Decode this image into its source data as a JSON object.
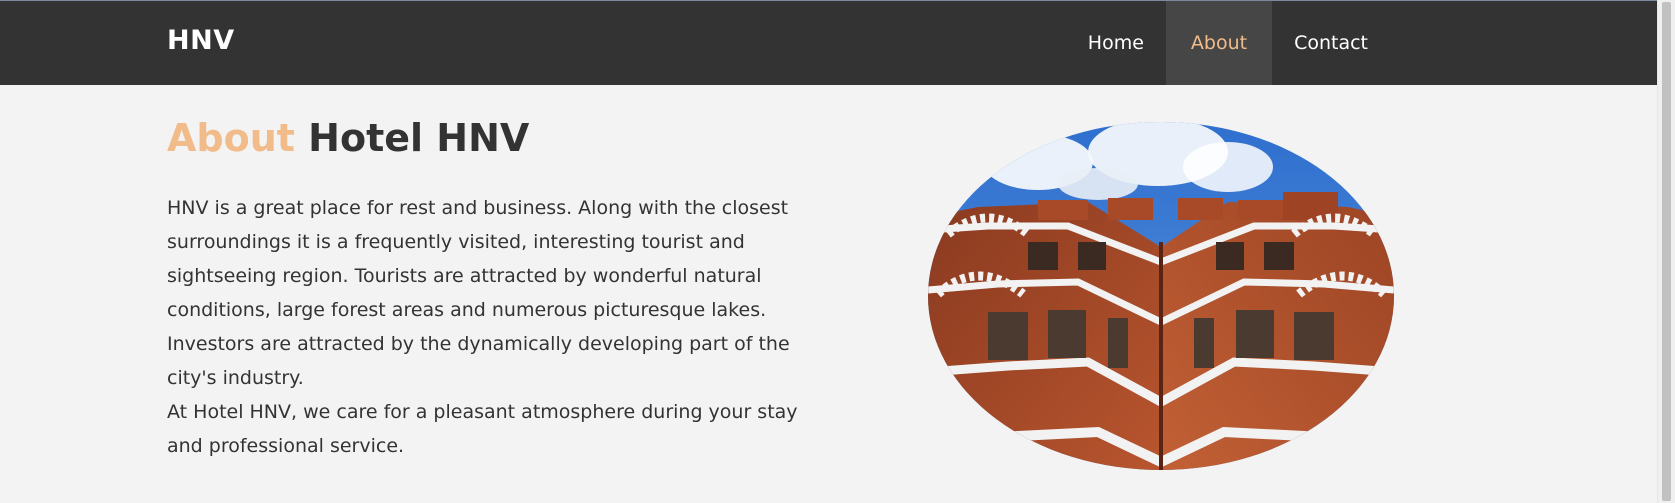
{
  "navbar": {
    "brand": "HNV",
    "items": [
      {
        "label": "Home",
        "active": false
      },
      {
        "label": "About",
        "active": true
      },
      {
        "label": "Contact",
        "active": false
      }
    ]
  },
  "main": {
    "heading_accent": "About",
    "heading_rest": "Hotel HNV",
    "paragraphs": [
      "HNV is a great place for rest and business. Along with the closest surroundings it is a frequently visited, interesting tourist and sightseeing region. Tourists are attracted by wonderful natural conditions, large forest areas and numerous picturesque lakes. Investors are attracted by the dynamically developing part of the city's industry.",
      "At Hotel HNV, we care for a pleasant atmosphere during your stay and professional service."
    ],
    "image": {
      "icon": "hotel-building-photo"
    }
  },
  "colors": {
    "navbar_bg": "#333333",
    "active_bg": "#464646",
    "accent": "#f2bb8a",
    "page_bg": "#f3f3f3",
    "text": "#333333"
  }
}
